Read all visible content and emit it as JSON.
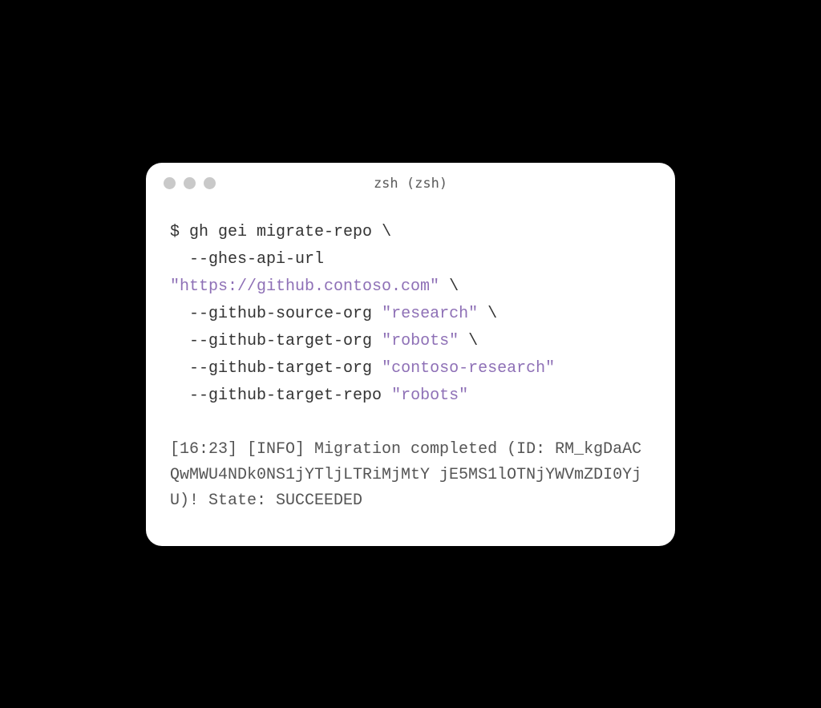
{
  "window": {
    "title": "zsh (zsh)"
  },
  "command": {
    "prompt": "$ ",
    "name": "gh gei migrate-repo",
    "cont": " \\",
    "lines": [
      {
        "indent": "  ",
        "flag": "--ghes-api-url",
        "value": "",
        "cont": ""
      },
      {
        "indent": "",
        "flag": "",
        "value": "\"https://github.contoso.com\"",
        "cont": " \\"
      },
      {
        "indent": "  ",
        "flag": "--github-source-org ",
        "value": "\"research\"",
        "cont": " \\"
      },
      {
        "indent": "  ",
        "flag": "--github-target-org ",
        "value": "\"robots\"",
        "cont": " \\"
      },
      {
        "indent": "  ",
        "flag": "--github-target-org ",
        "value": "\"contoso-research\"",
        "cont": ""
      },
      {
        "indent": "  ",
        "flag": "--github-target-repo ",
        "value": "\"robots\"",
        "cont": ""
      }
    ]
  },
  "output": {
    "text": "[16:23] [INFO] Migration completed (ID: RM_kgDaACQwMWU4NDk0NS1jYTljLTRiMjMtY jE5MS1lOTNjYWVmZDI0YjU)! State: SUCCEEDED"
  }
}
